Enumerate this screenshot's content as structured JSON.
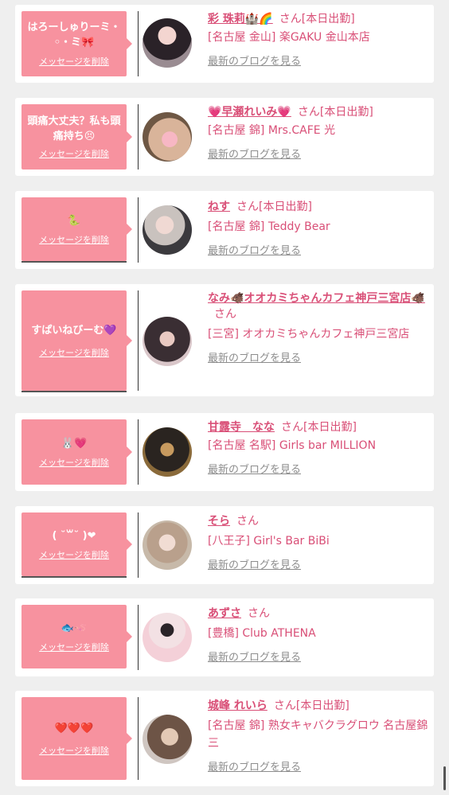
{
  "common": {
    "delete_label": "メッセージを削除",
    "blog_label": "最新のブログを見る",
    "san": "さん"
  },
  "cards": [
    {
      "bubble": "はろーしゅりーミ・◦・ミ🎀",
      "name": "彩 珠莉🏰🌈",
      "status": "[本日出勤]",
      "shop": "[名古屋 金山] 楽GAKU 金山本店"
    },
    {
      "bubble": "頭痛大丈夫？私も頭痛持ち😣",
      "name": "💗早瀬れいみ💗",
      "status": "[本日出勤]",
      "shop": "[名古屋 錦] Mrs.CAFE 光"
    },
    {
      "bubble": "🐍",
      "name": "ねす",
      "status": "[本日出勤]",
      "shop": "[名古屋 錦] Teddy Bear"
    },
    {
      "bubble": "すぱいねびーむ💜",
      "name": "なみ🐗オオカミちゃんカフェ神戸三宮店🐗",
      "status": "",
      "shop": "[三宮] オオカミちゃんカフェ神戸三宮店"
    },
    {
      "bubble": "🐰💗",
      "name": "甘露寺　なな",
      "status": "[本日出勤]",
      "shop": "[名古屋 名駅] Girls bar MILLION"
    },
    {
      "bubble": "( ˘꒳˘ )❤",
      "name": "そら",
      "status": "",
      "shop": "[八王子] Girl's Bar BiBi"
    },
    {
      "bubble": "🐟🪱",
      "name": "あずさ",
      "status": "",
      "shop": "[豊橋] Club ATHENA"
    },
    {
      "bubble": "❤️❤️❤️",
      "name": "城峰 れいら",
      "status": "[本日出勤]",
      "shop": "[名古屋 錦] 熟女キャバクラグロウ 名古屋錦三"
    }
  ],
  "colors": {
    "accent": "#d94f77",
    "bubble": "#f7929f",
    "muted": "#8d8d8d",
    "background": "#efefef"
  }
}
